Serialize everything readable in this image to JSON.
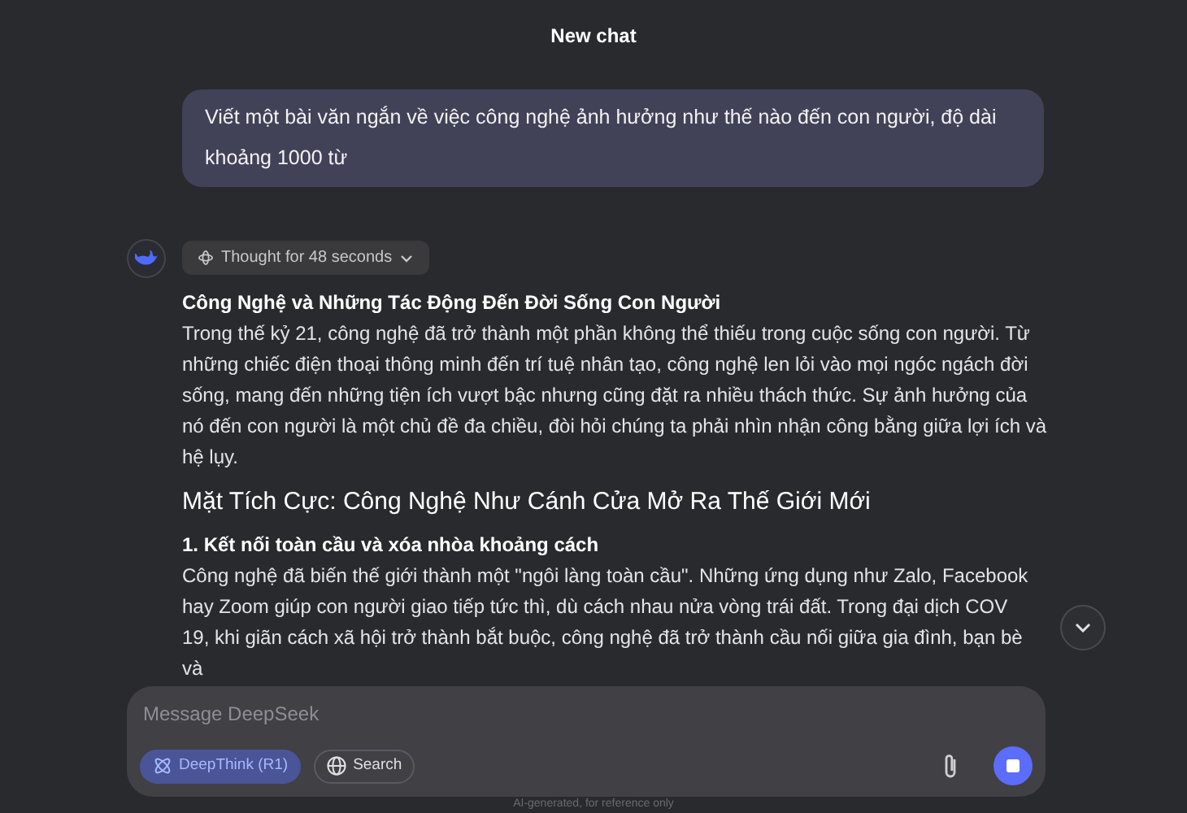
{
  "header": {
    "title": "New chat"
  },
  "user_message": {
    "text": "Viết một bài văn ngắn về việc công nghệ ảnh hưởng như thế nào đến con người, độ dài khoảng 1000 từ"
  },
  "assistant_message": {
    "thought": {
      "label": "Thought for 48 seconds",
      "expanded": false
    },
    "blocks": [
      {
        "kind": "title",
        "text": "Công Nghệ và Những Tác Động Đến Đời Sống Con Người"
      },
      {
        "kind": "paragraph",
        "text": "Trong thế kỷ 21, công nghệ đã trở thành một phần không thể thiếu trong cuộc sống con người. Từ những chiếc điện thoại thông minh đến trí tuệ nhân tạo, công nghệ len lỏi vào mọi ngóc ngách đời sống, mang đến những tiện ích vượt bậc nhưng cũng đặt ra nhiều thách thức. Sự ảnh hưởng của nó đến con người là một chủ đề đa chiều, đòi hỏi chúng ta phải nhìn nhận công bằng giữa lợi ích và hệ lụy."
      },
      {
        "kind": "heading",
        "text": "Mặt Tích Cực: Công Nghệ Như Cánh Cửa Mở Ra Thế Giới Mới"
      },
      {
        "kind": "title",
        "text": "1. Kết nối toàn cầu và xóa nhòa khoảng cách"
      },
      {
        "kind": "paragraph",
        "text": "Công nghệ đã biến thế giới thành một \"ngôi làng toàn cầu\". Những ứng dụng như Zalo, Facebook hay Zoom giúp con người giao tiếp tức thì, dù cách nhau nửa vòng trái đất. Trong đại dịch COV"
      },
      {
        "kind": "paragraph",
        "text": "19, khi giãn cách xã hội trở thành bắt buộc, công nghệ đã trở thành cầu nối giữa gia đình, bạn bè và"
      }
    ]
  },
  "composer": {
    "placeholder": "Message DeepSeek",
    "deepthink": {
      "label": "DeepThink (R1)",
      "selected": true
    },
    "search": {
      "label": "Search",
      "selected": false
    }
  },
  "footer": {
    "note": "AI-generated, for reference only"
  }
}
